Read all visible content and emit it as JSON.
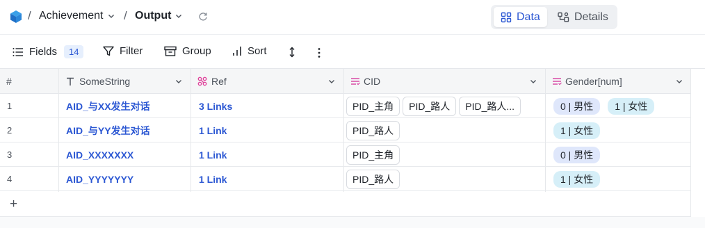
{
  "breadcrumb": {
    "project": "Achievement",
    "current": "Output"
  },
  "view_switch": {
    "data_label": "Data",
    "details_label": "Details",
    "active": "Data"
  },
  "toolbar": {
    "fields_label": "Fields",
    "fields_count": "14",
    "filter_label": "Filter",
    "group_label": "Group",
    "sort_label": "Sort"
  },
  "columns": [
    {
      "label": "#",
      "icon": "hash"
    },
    {
      "label": "SomeString",
      "icon": "text-type-icon"
    },
    {
      "label": "Ref",
      "icon": "link-type-icon"
    },
    {
      "label": "CID",
      "icon": "multi-select-icon"
    },
    {
      "label": "Gender[num]",
      "icon": "multi-select-icon"
    }
  ],
  "rows": [
    {
      "num": "1",
      "somestring": "AID_与XX发生对话",
      "ref": "3 Links",
      "cid": [
        "PID_主角",
        "PID_路人",
        "PID_路人..."
      ],
      "gender": [
        "0 | 男性",
        "1 | 女性"
      ]
    },
    {
      "num": "2",
      "somestring": "AID_与YY发生对话",
      "ref": "1 Link",
      "cid": [
        "PID_路人"
      ],
      "gender": [
        "1 | 女性"
      ]
    },
    {
      "num": "3",
      "somestring": "AID_XXXXXXX",
      "ref": "1 Link",
      "cid": [
        "PID_主角"
      ],
      "gender": [
        "0 | 男性"
      ]
    },
    {
      "num": "4",
      "somestring": "AID_YYYYYYY",
      "ref": "1 Link",
      "cid": [
        "PID_路人"
      ],
      "gender": [
        "1 | 女性"
      ]
    }
  ],
  "add_row_symbol": "+",
  "colors": {
    "accent": "#2b57d3",
    "male_pill": "#dfe7fb",
    "female_pill": "#d6eff8",
    "ref_icon": "#e0449c",
    "select_icon": "#d63fa0"
  }
}
